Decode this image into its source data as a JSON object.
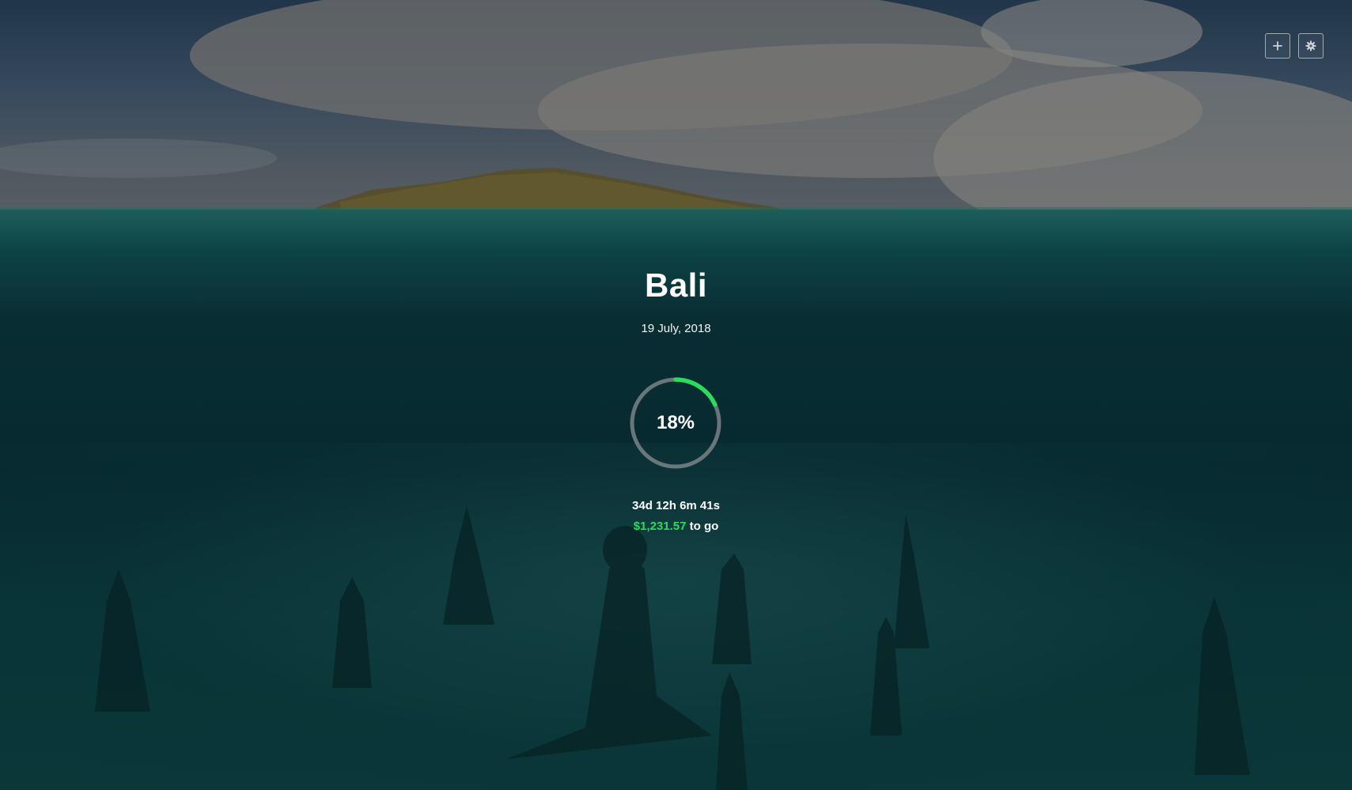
{
  "goal": {
    "title": "Bali",
    "date": "19 July, 2018",
    "progress_percent": 18,
    "progress_label": "18%",
    "countdown": "34d 12h 6m 41s",
    "amount_remaining": "$1,231.57",
    "remaining_suffix": " to go"
  },
  "toolbar": {
    "add_icon": "plus-icon",
    "settings_icon": "gear-icon"
  },
  "colors": {
    "accent": "#2bdc5c",
    "ring_track": "#8a8f93",
    "text": "#ffffff"
  }
}
